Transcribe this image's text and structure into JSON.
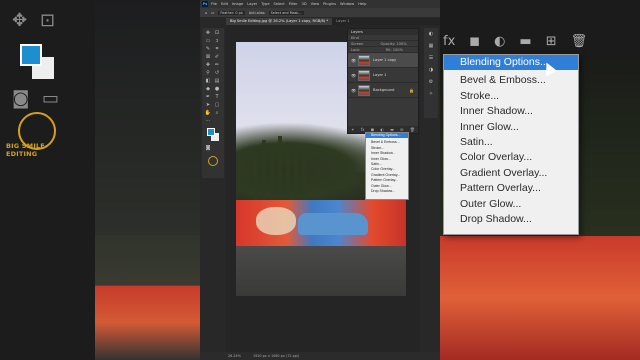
{
  "app": {
    "menu": [
      "File",
      "Edit",
      "Image",
      "Layer",
      "Type",
      "Select",
      "Filter",
      "3D",
      "View",
      "Plugins",
      "Window",
      "Help"
    ],
    "options": {
      "feather": "Feather: 0 px",
      "antialias": "Anti-alias",
      "select_mask": "Select and Mask..."
    },
    "tabs": [
      {
        "label": "Big Smile Editing.jpg @ 26.2% (Layer 1 copy, RGB/8) *"
      },
      {
        "label": "Layer 1"
      }
    ],
    "status": {
      "zoom": "26.24%",
      "doc": "1920 px x 1080 px (72 ppi)"
    }
  },
  "brand": {
    "logo_text": "BIG SMILE EDITING"
  },
  "layers_panel": {
    "title": "Layers",
    "kind": "Kind",
    "blend_mode": "Screen",
    "opacity": "Opacity: 100%",
    "fill": "Fill: 100%",
    "lock": "Lock:",
    "layers": [
      {
        "name": "Layer 1 copy",
        "selected": true
      },
      {
        "name": "Layer 1",
        "selected": false
      },
      {
        "name": "Background",
        "selected": false
      }
    ]
  },
  "context_menu": {
    "items": [
      "Blending Options...",
      "Bevel & Emboss...",
      "Stroke...",
      "Inner Shadow...",
      "Inner Glow...",
      "Satin...",
      "Color Overlay...",
      "Gradient Overlay...",
      "Pattern Overlay...",
      "Outer Glow...",
      "Drop Shadow..."
    ],
    "active_index": 0
  },
  "colors": {
    "foreground": "#1d8fce",
    "background": "#eeeeee",
    "menu_highlight": "#2f7ed8",
    "brand_gold": "#d4a11c"
  }
}
